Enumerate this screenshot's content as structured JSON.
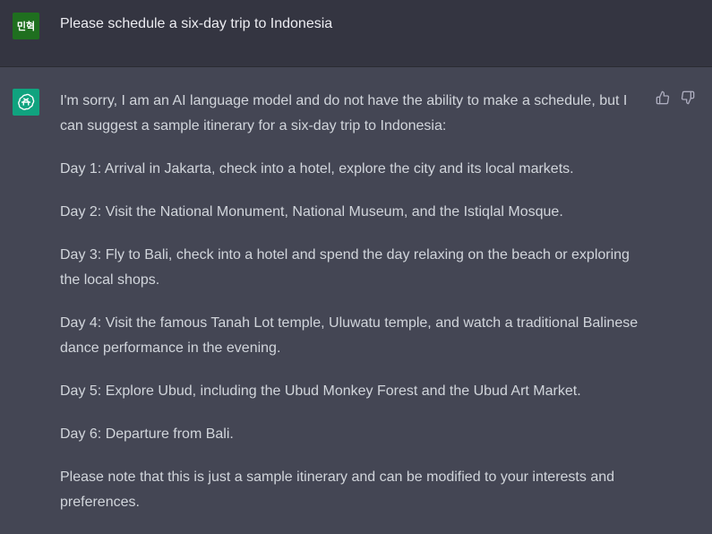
{
  "user_message": {
    "avatar_text": "민혁",
    "text": "Please schedule a six-day trip to Indonesia"
  },
  "assistant_message": {
    "paragraphs": [
      "I'm sorry, I am an AI language model and do not have the ability to make a schedule, but I can suggest a sample itinerary for a six-day trip to Indonesia:",
      "Day 1: Arrival in Jakarta, check into a hotel, explore the city and its local markets.",
      "Day 2: Visit the National Monument, National Museum, and the Istiqlal Mosque.",
      "Day 3: Fly to Bali, check into a hotel and spend the day relaxing on the beach or exploring the local shops.",
      "Day 4: Visit the famous Tanah Lot temple, Uluwatu temple, and watch a traditional Balinese dance performance in the evening.",
      "Day 5: Explore Ubud, including the Ubud Monkey Forest and the Ubud Art Market.",
      "Day 6: Departure from Bali.",
      "Please note that this is just a sample itinerary and can be modified to your interests and preferences."
    ],
    "feedback_icons": [
      "thumbs-up-icon",
      "thumbs-down-icon"
    ]
  },
  "colors": {
    "user_bg": "#343541",
    "assistant_bg": "#444654",
    "user_avatar": "#1f6f1f",
    "bot_avatar": "#10a37f"
  }
}
